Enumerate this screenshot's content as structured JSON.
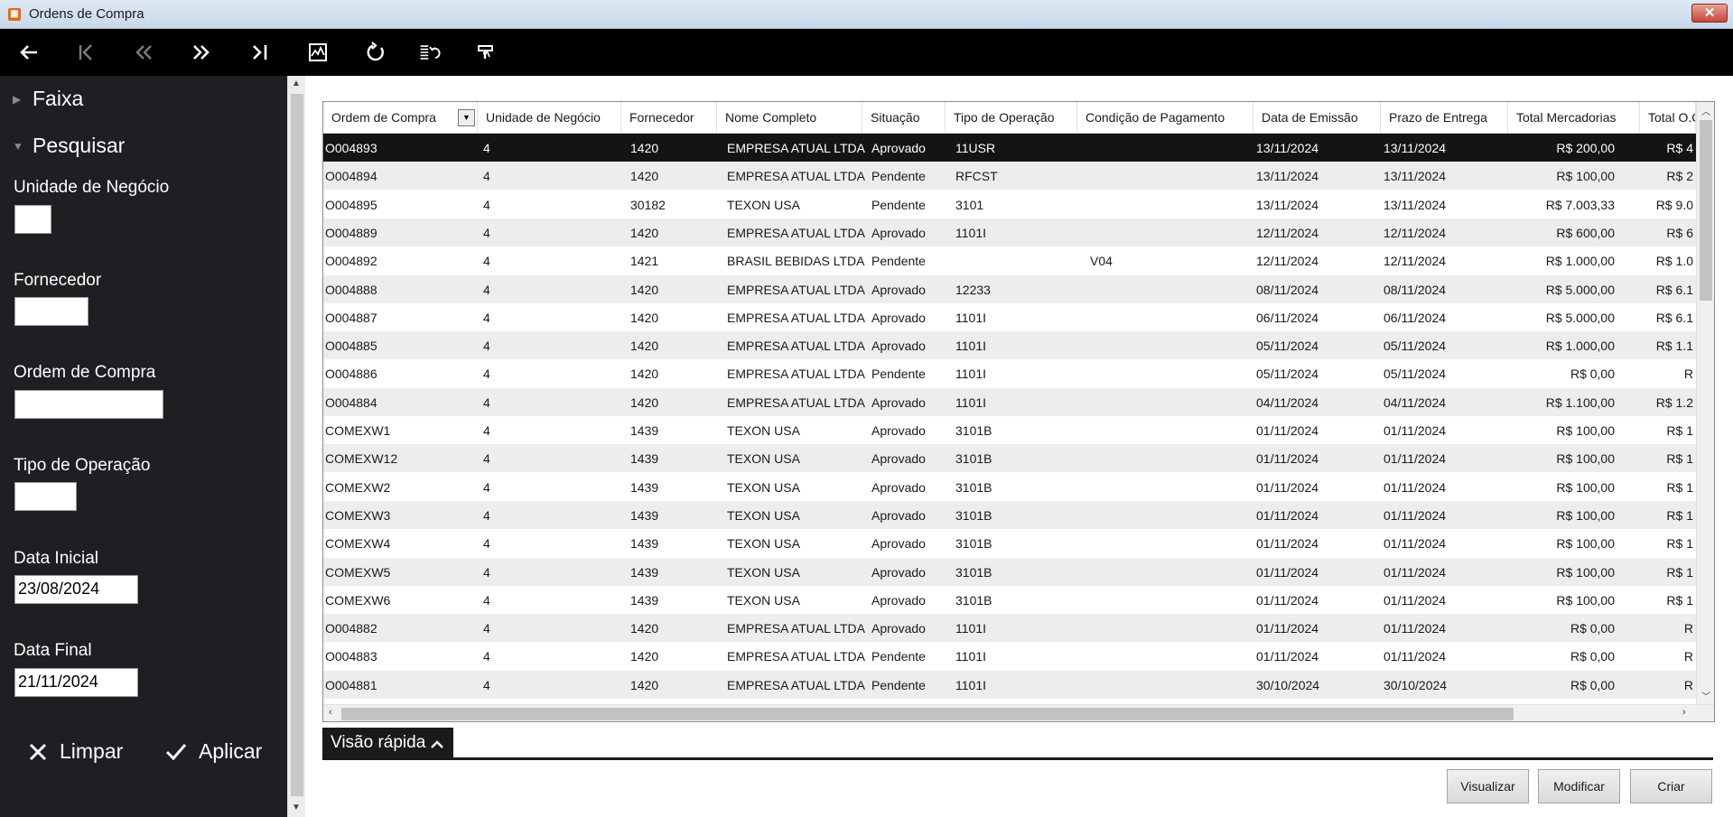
{
  "window": {
    "title": "Ordens de Compra",
    "close_glyph": "✕"
  },
  "toolbar": {
    "buttons": [
      {
        "name": "back-arrow-icon",
        "glyph": "←"
      },
      {
        "name": "first-page-icon",
        "glyph": "⟨"
      },
      {
        "name": "previous-page-icon",
        "glyph": "«"
      },
      {
        "name": "next-page-icon",
        "glyph": "»"
      },
      {
        "name": "last-page-icon",
        "glyph": "›|"
      },
      {
        "name": "chart-icon",
        "glyph": ""
      },
      {
        "name": "refresh-icon",
        "glyph": "↻"
      },
      {
        "name": "undo-list-icon",
        "glyph": ""
      },
      {
        "name": "paint-brush-icon",
        "glyph": ""
      }
    ]
  },
  "sidebar": {
    "faixa_label": "Faixa",
    "pesquisar_label": "Pesquisar",
    "fields": {
      "unidade_label": "Unidade de Negócio",
      "unidade_value": "",
      "fornecedor_label": "Fornecedor",
      "fornecedor_value": "",
      "ordem_label": "Ordem de Compra",
      "ordem_value": "",
      "tipo_label": "Tipo de Operação",
      "tipo_value": "",
      "data_inicial_label": "Data Inicial",
      "data_inicial_value": "23/08/2024",
      "data_final_label": "Data Final",
      "data_final_value": "21/11/2024"
    },
    "clear_label": "Limpar",
    "apply_label": "Aplicar"
  },
  "grid": {
    "columns": [
      "Ordem de Compra",
      "Unidade de Negócio",
      "Fornecedor",
      "Nome Completo",
      "Situação",
      "Tipo de Operação",
      "Condição de Pagamento",
      "Data de Emissão",
      "Prazo de Entrega",
      "Total Mercadorias",
      "Total O.C."
    ],
    "rows": [
      {
        "ordem": "O004893",
        "unidade": "4",
        "fornecedor": "1420",
        "nome": "EMPRESA ATUAL LTDA",
        "situacao": "Aprovado",
        "tipo": "11USR",
        "condicao": "",
        "emissao": "13/11/2024",
        "prazo": "13/11/2024",
        "total_merc": "R$ 200,00",
        "total_oc": "R$ 4",
        "selected": true
      },
      {
        "ordem": "O004894",
        "unidade": "4",
        "fornecedor": "1420",
        "nome": "EMPRESA ATUAL LTDA",
        "situacao": "Pendente",
        "tipo": "RFCST",
        "condicao": "",
        "emissao": "13/11/2024",
        "prazo": "13/11/2024",
        "total_merc": "R$ 100,00",
        "total_oc": "R$ 2"
      },
      {
        "ordem": "O004895",
        "unidade": "4",
        "fornecedor": "30182",
        "nome": "TEXON USA",
        "situacao": "Pendente",
        "tipo": "3101",
        "condicao": "",
        "emissao": "13/11/2024",
        "prazo": "13/11/2024",
        "total_merc": "R$ 7.003,33",
        "total_oc": "R$ 9.0"
      },
      {
        "ordem": "O004889",
        "unidade": "4",
        "fornecedor": "1420",
        "nome": "EMPRESA ATUAL LTDA",
        "situacao": "Aprovado",
        "tipo": "1101I",
        "condicao": "",
        "emissao": "12/11/2024",
        "prazo": "12/11/2024",
        "total_merc": "R$ 600,00",
        "total_oc": "R$ 6"
      },
      {
        "ordem": "O004892",
        "unidade": "4",
        "fornecedor": "1421",
        "nome": "BRASIL BEBIDAS LTDA",
        "situacao": "Pendente",
        "tipo": "",
        "condicao": "V04",
        "emissao": "12/11/2024",
        "prazo": "12/11/2024",
        "total_merc": "R$ 1.000,00",
        "total_oc": "R$ 1.0"
      },
      {
        "ordem": "O004888",
        "unidade": "4",
        "fornecedor": "1420",
        "nome": "EMPRESA ATUAL LTDA",
        "situacao": "Aprovado",
        "tipo": "12233",
        "condicao": "",
        "emissao": "08/11/2024",
        "prazo": "08/11/2024",
        "total_merc": "R$ 5.000,00",
        "total_oc": "R$ 6.1"
      },
      {
        "ordem": "O004887",
        "unidade": "4",
        "fornecedor": "1420",
        "nome": "EMPRESA ATUAL LTDA",
        "situacao": "Aprovado",
        "tipo": "1101I",
        "condicao": "",
        "emissao": "06/11/2024",
        "prazo": "06/11/2024",
        "total_merc": "R$ 5.000,00",
        "total_oc": "R$ 6.1"
      },
      {
        "ordem": "O004885",
        "unidade": "4",
        "fornecedor": "1420",
        "nome": "EMPRESA ATUAL LTDA",
        "situacao": "Aprovado",
        "tipo": "1101I",
        "condicao": "",
        "emissao": "05/11/2024",
        "prazo": "05/11/2024",
        "total_merc": "R$ 1.000,00",
        "total_oc": "R$ 1.1"
      },
      {
        "ordem": "O004886",
        "unidade": "4",
        "fornecedor": "1420",
        "nome": "EMPRESA ATUAL LTDA",
        "situacao": "Pendente",
        "tipo": "1101I",
        "condicao": "",
        "emissao": "05/11/2024",
        "prazo": "05/11/2024",
        "total_merc": "R$ 0,00",
        "total_oc": "R"
      },
      {
        "ordem": "O004884",
        "unidade": "4",
        "fornecedor": "1420",
        "nome": "EMPRESA ATUAL LTDA",
        "situacao": "Aprovado",
        "tipo": "1101I",
        "condicao": "",
        "emissao": "04/11/2024",
        "prazo": "04/11/2024",
        "total_merc": "R$ 1.100,00",
        "total_oc": "R$ 1.2"
      },
      {
        "ordem": "COMEXW1",
        "unidade": "4",
        "fornecedor": "1439",
        "nome": "TEXON USA",
        "situacao": "Aprovado",
        "tipo": "3101B",
        "condicao": "",
        "emissao": "01/11/2024",
        "prazo": "01/11/2024",
        "total_merc": "R$ 100,00",
        "total_oc": "R$ 1"
      },
      {
        "ordem": "COMEXW12",
        "unidade": "4",
        "fornecedor": "1439",
        "nome": "TEXON USA",
        "situacao": "Aprovado",
        "tipo": "3101B",
        "condicao": "",
        "emissao": "01/11/2024",
        "prazo": "01/11/2024",
        "total_merc": "R$ 100,00",
        "total_oc": "R$ 1"
      },
      {
        "ordem": "COMEXW2",
        "unidade": "4",
        "fornecedor": "1439",
        "nome": "TEXON USA",
        "situacao": "Aprovado",
        "tipo": "3101B",
        "condicao": "",
        "emissao": "01/11/2024",
        "prazo": "01/11/2024",
        "total_merc": "R$ 100,00",
        "total_oc": "R$ 1"
      },
      {
        "ordem": "COMEXW3",
        "unidade": "4",
        "fornecedor": "1439",
        "nome": "TEXON USA",
        "situacao": "Aprovado",
        "tipo": "3101B",
        "condicao": "",
        "emissao": "01/11/2024",
        "prazo": "01/11/2024",
        "total_merc": "R$ 100,00",
        "total_oc": "R$ 1"
      },
      {
        "ordem": "COMEXW4",
        "unidade": "4",
        "fornecedor": "1439",
        "nome": "TEXON USA",
        "situacao": "Aprovado",
        "tipo": "3101B",
        "condicao": "",
        "emissao": "01/11/2024",
        "prazo": "01/11/2024",
        "total_merc": "R$ 100,00",
        "total_oc": "R$ 1"
      },
      {
        "ordem": "COMEXW5",
        "unidade": "4",
        "fornecedor": "1439",
        "nome": "TEXON USA",
        "situacao": "Aprovado",
        "tipo": "3101B",
        "condicao": "",
        "emissao": "01/11/2024",
        "prazo": "01/11/2024",
        "total_merc": "R$ 100,00",
        "total_oc": "R$ 1"
      },
      {
        "ordem": "COMEXW6",
        "unidade": "4",
        "fornecedor": "1439",
        "nome": "TEXON USA",
        "situacao": "Aprovado",
        "tipo": "3101B",
        "condicao": "",
        "emissao": "01/11/2024",
        "prazo": "01/11/2024",
        "total_merc": "R$ 100,00",
        "total_oc": "R$ 1"
      },
      {
        "ordem": "O004882",
        "unidade": "4",
        "fornecedor": "1420",
        "nome": "EMPRESA ATUAL LTDA",
        "situacao": "Aprovado",
        "tipo": "1101I",
        "condicao": "",
        "emissao": "01/11/2024",
        "prazo": "01/11/2024",
        "total_merc": "R$ 0,00",
        "total_oc": "R"
      },
      {
        "ordem": "O004883",
        "unidade": "4",
        "fornecedor": "1420",
        "nome": "EMPRESA ATUAL LTDA",
        "situacao": "Pendente",
        "tipo": "1101I",
        "condicao": "",
        "emissao": "01/11/2024",
        "prazo": "01/11/2024",
        "total_merc": "R$ 0,00",
        "total_oc": "R"
      },
      {
        "ordem": "O004881",
        "unidade": "4",
        "fornecedor": "1420",
        "nome": "EMPRESA ATUAL LTDA",
        "situacao": "Pendente",
        "tipo": "1101I",
        "condicao": "",
        "emissao": "30/10/2024",
        "prazo": "30/10/2024",
        "total_merc": "R$ 0,00",
        "total_oc": "R"
      }
    ]
  },
  "quick_view": {
    "label": "Visão rápida"
  },
  "actions": {
    "view_label": "Visualizar",
    "modify_label": "Modificar",
    "create_label": "Criar"
  },
  "colors": {
    "sidebar_bg": "#1f1f23",
    "toolbar_bg": "#000000",
    "selected_row_bg": "#141416",
    "alt_row_bg": "#ededed"
  }
}
